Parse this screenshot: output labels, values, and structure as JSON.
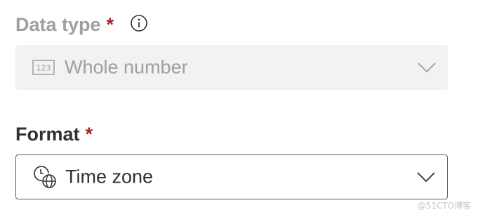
{
  "data_type": {
    "label": "Data type",
    "required_mark": "*",
    "info_icon": "info-icon",
    "selected_value": "Whole number",
    "value_icon": "number-icon",
    "disabled": true
  },
  "format": {
    "label": "Format",
    "required_mark": "*",
    "selected_value": "Time zone",
    "value_icon": "time-zone-icon",
    "disabled": false
  },
  "watermark": "@51CTO博客",
  "colors": {
    "required": "#a4262c",
    "disabled_text": "#a19f9d",
    "disabled_bg": "#f3f2f1",
    "text": "#323130",
    "border": "#605e5c"
  }
}
